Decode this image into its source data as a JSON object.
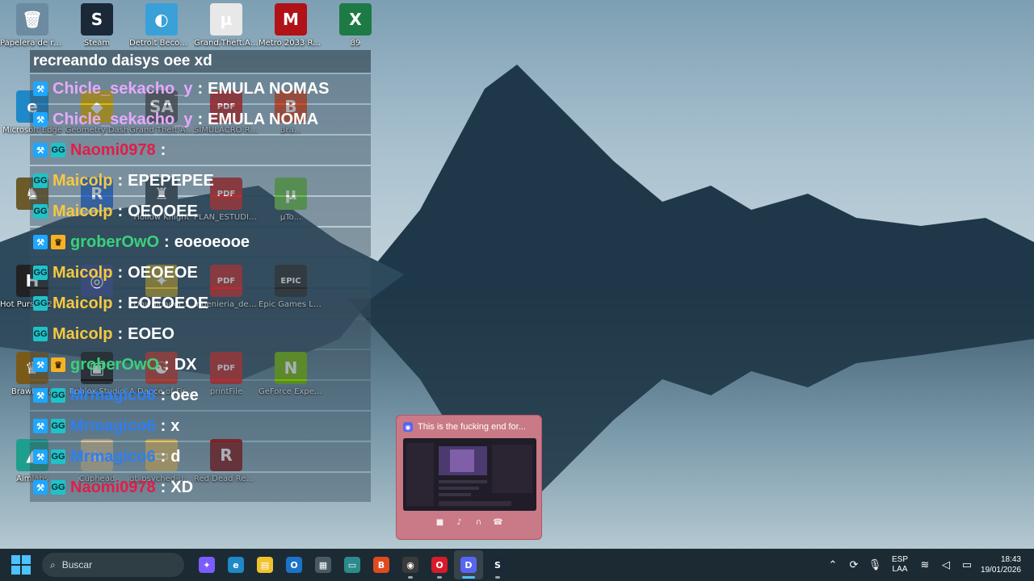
{
  "desktop": {
    "icons": [
      {
        "label": "Papelera de reciclaje",
        "glyph": "🗑",
        "color": "#6c8aa0"
      },
      {
        "label": "Steam",
        "glyph": "S",
        "color": "#1b2838"
      },
      {
        "label": "Detroit Become Human",
        "glyph": "◐",
        "color": "#3aa0d8"
      },
      {
        "label": "Grand.Theft.Aut...",
        "glyph": "µ",
        "color": "#e8e8e8"
      },
      {
        "label": "Metro 2033 Redux",
        "glyph": "M",
        "color": "#b01218"
      },
      {
        "label": "89",
        "glyph": "X",
        "color": "#1d7a45"
      },
      {
        "label": "Microsoft Edge",
        "glyph": "e",
        "color": "#1e88c8"
      },
      {
        "label": "Geometry Dash",
        "glyph": "◆",
        "color": "#e6b800"
      },
      {
        "label": "Grand Theft Auto San Andreas",
        "glyph": "SA",
        "color": "#5a5a5a"
      },
      {
        "label": "SIMULACRO REPASO U...",
        "glyph": "PDF",
        "color": "#c62828"
      },
      {
        "label": "Bra...",
        "glyph": "B",
        "color": "#e04a1f"
      },
      {
        "label": "",
        "glyph": "♞",
        "color": "#6b5a2a"
      },
      {
        "label": "",
        "glyph": "R",
        "color": "#2f6fd6"
      },
      {
        "label": "Hollow Knight",
        "glyph": "♜",
        "color": "#3b4a55"
      },
      {
        "label": "PLAN_ESTUDIO...",
        "glyph": "PDF",
        "color": "#c62828"
      },
      {
        "label": "µTo...",
        "glyph": "µ",
        "color": "#6cc04a"
      },
      {
        "label": "Hot Pursuit 2010",
        "glyph": "H",
        "color": "#222"
      },
      {
        "label": "",
        "glyph": "◎",
        "color": "#3a4a8a"
      },
      {
        "label": "Downloader 2",
        "glyph": "✦",
        "color": "#b59b2a"
      },
      {
        "label": "Ingenieria_de_S...",
        "glyph": "PDF",
        "color": "#c62828"
      },
      {
        "label": "Epic Games Launcher",
        "glyph": "EPIC",
        "color": "#2a2a2a"
      },
      {
        "label": "Brawlhalla",
        "glyph": "♛",
        "color": "#7a5a1a"
      },
      {
        "label": "Roblox Studio",
        "glyph": "▣",
        "color": "#1a1a1a"
      },
      {
        "label": "A Dance of Fire and Ice",
        "glyph": "☯",
        "color": "#c0392b"
      },
      {
        "label": "printFile",
        "glyph": "PDF",
        "color": "#c62828"
      },
      {
        "label": "GeForce Experience",
        "glyph": "N",
        "color": "#76b900"
      },
      {
        "label": "Aimlabs",
        "glyph": "▲",
        "color": "#1f9e8e"
      },
      {
        "label": "Cuphead",
        "glyph": "☕",
        "color": "#d8c39a"
      },
      {
        "label": "qt_psyched-up-...",
        "glyph": "▭",
        "color": "#e5c26a"
      },
      {
        "label": "Red Dead Redemption",
        "glyph": "R",
        "color": "#8a1c1c"
      }
    ]
  },
  "chat": {
    "title": "recreando daisys oee xd",
    "messages": [
      {
        "badges": [
          "mod"
        ],
        "user": "Chicle_sekacho_y",
        "color": "#e7a8ff",
        "text": "EMULA NOMAS"
      },
      {
        "badges": [
          "mod"
        ],
        "user": "Chicle_sekacho_y",
        "color": "#e7a8ff",
        "text": "EMULA NOMA"
      },
      {
        "badges": [
          "mod",
          "vip"
        ],
        "user": "Naomi0978",
        "color": "#e11d48",
        "text": ""
      },
      {
        "badges": [
          "vip"
        ],
        "user": "Maicolp",
        "color": "#f5c842",
        "text": "EPEPEPEE"
      },
      {
        "badges": [
          "vip"
        ],
        "user": "Maicolp",
        "color": "#f5c842",
        "text": "OEOOEE"
      },
      {
        "badges": [
          "mod",
          "sub"
        ],
        "user": "groberOwO",
        "color": "#3ad17c",
        "text": "eoeoeooe"
      },
      {
        "badges": [
          "vip"
        ],
        "user": "Maicolp",
        "color": "#f5c842",
        "text": "OEOEOE"
      },
      {
        "badges": [
          "vip"
        ],
        "user": "Maicolp",
        "color": "#f5c842",
        "text": "EOEOEOE"
      },
      {
        "badges": [
          "vip"
        ],
        "user": "Maicolp",
        "color": "#f5c842",
        "text": "EOEO"
      },
      {
        "badges": [
          "mod",
          "sub"
        ],
        "user": "groberOwO",
        "color": "#3ad17c",
        "text": "DX"
      },
      {
        "badges": [
          "mod",
          "vip"
        ],
        "user": "Mrmagico6",
        "color": "#2e7ff0",
        "text": "oee"
      },
      {
        "badges": [
          "mod",
          "vip"
        ],
        "user": "Mrmagico6",
        "color": "#2e7ff0",
        "text": "x"
      },
      {
        "badges": [
          "mod",
          "vip"
        ],
        "user": "Mrmagico6",
        "color": "#2e7ff0",
        "text": "d"
      },
      {
        "badges": [
          "mod",
          "vip"
        ],
        "user": "Naomi0978",
        "color": "#e11d48",
        "text": "XD"
      }
    ]
  },
  "notification": {
    "title": "This is the fucking end for...",
    "app_icon": "discord-icon",
    "controls": [
      "camera-icon",
      "mic-icon",
      "headphones-icon",
      "hangup-icon"
    ]
  },
  "taskbar": {
    "search_placeholder": "Buscar",
    "apps": [
      {
        "name": "copilot-icon",
        "glyph": "✦",
        "color": "#7c5cff"
      },
      {
        "name": "edge-icon",
        "glyph": "e",
        "color": "#1e88c8"
      },
      {
        "name": "file-explorer-icon",
        "glyph": "▤",
        "color": "#f2c12e"
      },
      {
        "name": "outlook-icon",
        "glyph": "O",
        "color": "#1a73c8"
      },
      {
        "name": "calculator-icon",
        "glyph": "▦",
        "color": "#4a5a64"
      },
      {
        "name": "terminal-icon",
        "glyph": "▭",
        "color": "#2c8a8a"
      },
      {
        "name": "brave-icon",
        "glyph": "B",
        "color": "#e04a1f"
      },
      {
        "name": "obs-icon",
        "glyph": "◉",
        "color": "#3a3a3a"
      },
      {
        "name": "opera-icon",
        "glyph": "O",
        "color": "#d81b2a"
      },
      {
        "name": "discord-icon",
        "glyph": "D",
        "color": "#5865f2"
      },
      {
        "name": "steam-icon",
        "glyph": "S",
        "color": "#1b2838"
      }
    ],
    "active_app": "discord-icon",
    "tray": {
      "lang_top": "ESP",
      "lang_bottom": "LAA",
      "time": "18:43",
      "date": "19/01/2026"
    }
  }
}
